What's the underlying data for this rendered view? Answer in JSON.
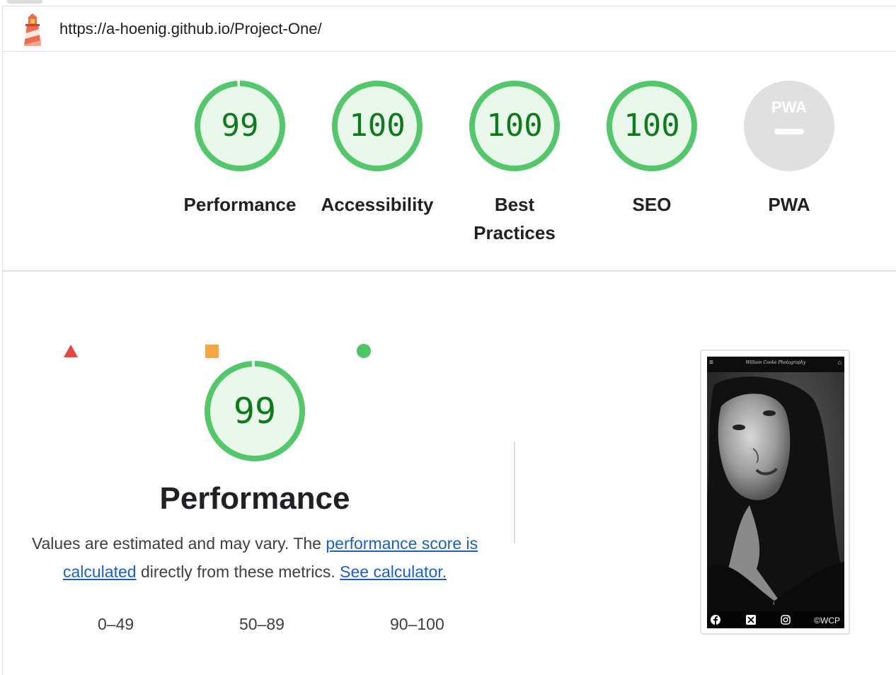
{
  "header": {
    "url": "https://a-hoenig.github.io/Project-One/",
    "logo_icon": "lighthouse-icon"
  },
  "categories": [
    {
      "label": "Performance",
      "score": "99",
      "value": 99
    },
    {
      "label": "Accessibility",
      "score": "100",
      "value": 100
    },
    {
      "label": "Best Practices",
      "score": "100",
      "value": 100
    },
    {
      "label": "SEO",
      "score": "100",
      "value": 100
    },
    {
      "label": "PWA",
      "score": "",
      "badge": "PWA"
    }
  ],
  "performance": {
    "score": "99",
    "value": 99,
    "title": "Performance",
    "desc_prefix": "Values are estimated and may vary. The ",
    "desc_link1": "performance score is calculated",
    "desc_middle": " directly from these metrics. ",
    "desc_link2": "See calculator."
  },
  "legend": [
    {
      "range": "0–49",
      "shape": "triangle",
      "color": "#e8453c"
    },
    {
      "range": "50–89",
      "shape": "square",
      "color": "#f5a742"
    },
    {
      "range": "90–100",
      "shape": "circle",
      "color": "#4dc465"
    }
  ],
  "screenshot": {
    "brand": "William Cooke Photography",
    "footer_text": "©WCP",
    "icons": [
      "facebook-icon",
      "x-icon",
      "instagram-icon"
    ]
  },
  "colors": {
    "pass": "#0c7b1a",
    "pass_ring": "#52c86a",
    "pass_fill": "#eaf8ec",
    "pwa_gray": "#e0e0e0",
    "link": "#1a5fd0"
  }
}
